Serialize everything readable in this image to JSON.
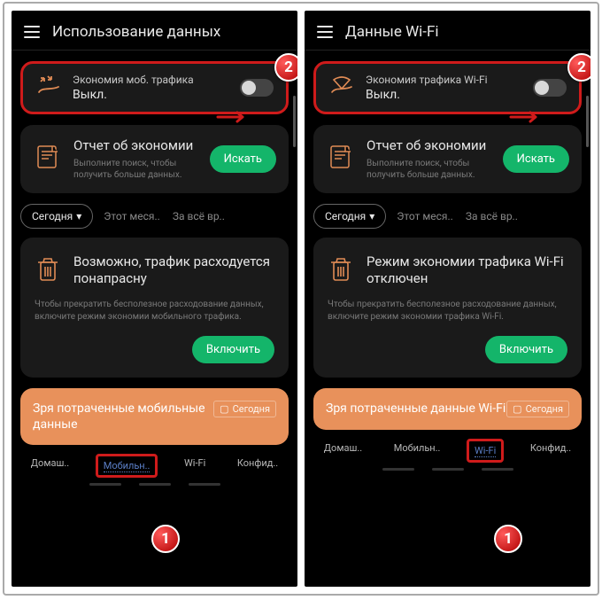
{
  "left": {
    "title": "Использование данных",
    "toggle": {
      "title": "Экономия моб. трафика",
      "status": "Выкл."
    },
    "report": {
      "title": "Отчет об экономии",
      "sub": "Выполните поиск, чтобы получить больше данных.",
      "button": "Искать"
    },
    "range": {
      "chip": "Сегодня",
      "t2": "Этот меся..",
      "t3": "За всё вр.."
    },
    "warn": {
      "title": "Возможно, трафик расходуется понапрасну",
      "sub": "Чтобы прекратить бесполезное расходование данных, включите режим экономии мобильного трафика.",
      "button": "Включить"
    },
    "wasted": {
      "title": "Зря потраченные мобильные данные",
      "today": "Сегодня"
    },
    "nav": {
      "home": "Домаш..",
      "mobile": "Мобильн..",
      "wifi": "Wi-Fi",
      "priv": "Конфид.."
    }
  },
  "right": {
    "title": "Данные Wi-Fi",
    "toggle": {
      "title": "Экономия трафика Wi-Fi",
      "status": "Выкл."
    },
    "report": {
      "title": "Отчет об экономии",
      "sub": "Выполните поиск, чтобы получить больше данных.",
      "button": "Искать"
    },
    "range": {
      "chip": "Сегодня",
      "t2": "Этот меся..",
      "t3": "За всё вр.."
    },
    "warn": {
      "title": "Режим экономии трафика Wi-Fi отключен",
      "sub": "Чтобы прекратить бесполезное расходование данных, включите режим экономии трафика Wi-Fi.",
      "button": "Включить"
    },
    "wasted": {
      "title": "Зря потраченные данные Wi-Fi",
      "today": "Сегодня"
    },
    "nav": {
      "home": "Домаш..",
      "mobile": "Мобильн..",
      "wifi": "Wi-Fi",
      "priv": "Конфид.."
    }
  },
  "badges": {
    "one": "1",
    "two": "2"
  }
}
